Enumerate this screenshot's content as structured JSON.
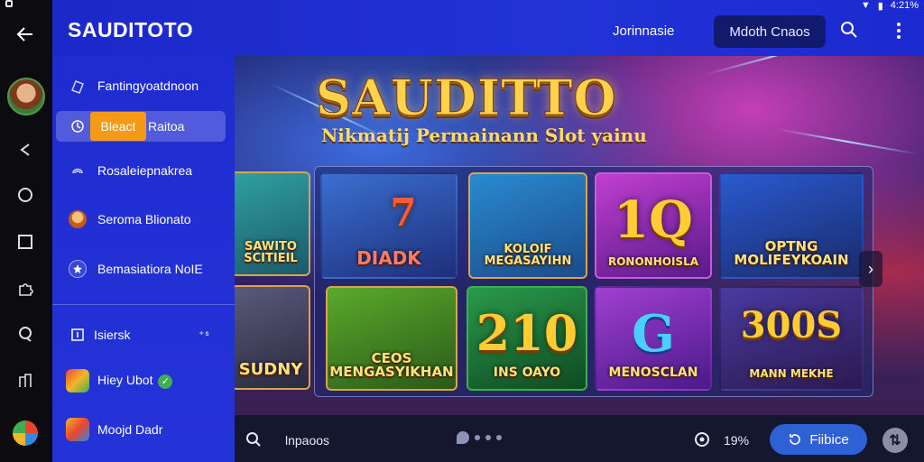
{
  "system": {
    "status_text": "4:21%",
    "icons": [
      "wifi-icon",
      "signal-icon",
      "battery-icon"
    ]
  },
  "rail": {
    "icons": [
      "back-arrow-icon",
      "avatar",
      "share-icon",
      "home-circle-icon",
      "square-icon",
      "puzzle-icon",
      "chat-icon",
      "building-icon",
      "browser-icon"
    ]
  },
  "header": {
    "brand": "SAUDITOTO",
    "link_label": "Jоrinnasie",
    "button_label": "Mdoth Cnaos",
    "icons": [
      "search-icon",
      "more-vertical-icon"
    ]
  },
  "sidebar": {
    "items": [
      {
        "label": "Fantingyoatdnoon",
        "icon": "casino-chip-icon"
      },
      {
        "chip": "Bleact",
        "label": "Raitoa",
        "icon": "clock-icon"
      },
      {
        "label": "Rosaleiepnakrea",
        "icon": "swirl-icon"
      },
      {
        "label": "Seroma Blionato",
        "icon": "character-icon"
      },
      {
        "label": "Bemasiatiora NoIE",
        "icon": "star-badge-icon"
      },
      {
        "label": "Isiersk",
        "icon": "square-dot-icon",
        "trailing": "⁺ˢ"
      },
      {
        "label": "Hiey Ubot",
        "icon": "dice-icon",
        "badge": "✓"
      },
      {
        "label": "Moojd Dadr",
        "icon": "dice-cube-icon"
      }
    ]
  },
  "hero": {
    "title": "SAUDITTO",
    "subtitle": "Nikmatij Permainann Slot yainu",
    "tiles": [
      {
        "name": "SAWITO\nSCITIEIL",
        "big": "",
        "bg": "#1b7a7a"
      },
      {
        "name": "DIADK",
        "big": "7",
        "bg": "#2a5aa0"
      },
      {
        "name": "KOLOIF\nMEGASAYIHN",
        "big": "",
        "bg": "#1e6fa8"
      },
      {
        "name": "RONONHOISLA",
        "big": "1Q",
        "bg": "#9c2fb0"
      },
      {
        "name": "OPTNG\nMOLIFEYKOAIN",
        "big": "",
        "bg": "#1d3f9c"
      },
      {
        "name": "SUDNY",
        "big": "",
        "bg": "#3a3a52"
      },
      {
        "name": "CEOS\nMENGASYIKHAN",
        "big": "",
        "bg": "#2e7a2a"
      },
      {
        "name": "INS OAYO",
        "big": "210",
        "bg": "#1e6f33"
      },
      {
        "name": "MENOSCLAN",
        "big": "G",
        "bg": "#7c2a9e"
      },
      {
        "name": "MANN MEKHE",
        "big": "300S",
        "bg": "#3a2a6a"
      }
    ]
  },
  "bottombar": {
    "input_text": "lnpaoos",
    "percent": "19%",
    "button_label": "Fiibice",
    "icons": [
      "search-icon",
      "chat-bubble-icon",
      "target-icon",
      "swap-icon"
    ]
  },
  "colors": {
    "header_blue": "#1c28c9",
    "accent_orange": "#f59a16",
    "button_blue": "#2f61d6",
    "gold": "#ffd24a"
  }
}
